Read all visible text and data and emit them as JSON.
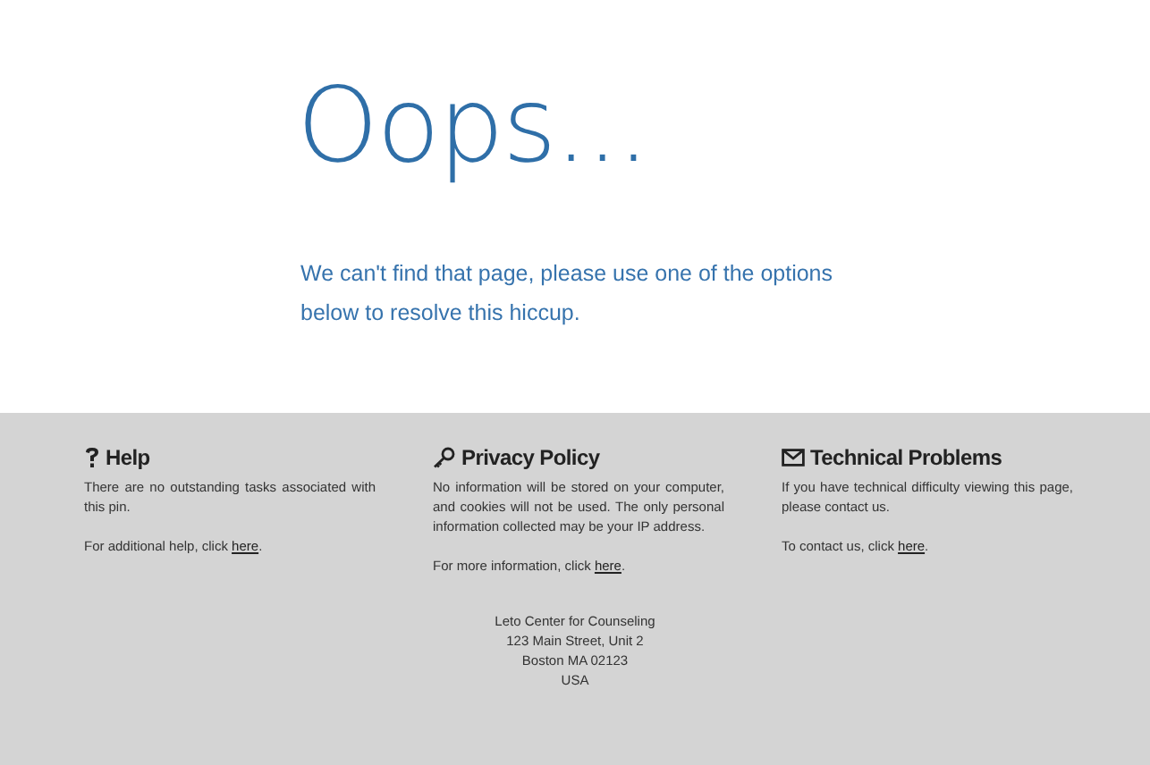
{
  "headline": "Oops...",
  "message": "We can't find that page, please use one of the options below to resolve this hiccup.",
  "footer": {
    "columns": [
      {
        "kind": "help",
        "title": "Help",
        "text": "There are no outstanding tasks associated with this pin.",
        "more": "For additional help, click ",
        "link": "here",
        "end": "."
      },
      {
        "kind": "privacy",
        "title": "Privacy Policy",
        "text": "No information will be stored on your computer, and cookies will not be used. The only personal information collected may be your IP address.",
        "more": "For more information, click ",
        "link": "here",
        "end": "."
      },
      {
        "kind": "contact",
        "title": "Technical Problems",
        "text": "If you have technical difficulty viewing this page, please contact us.",
        "more": "To contact us, click ",
        "link": "here",
        "end": "."
      }
    ],
    "address": [
      "Leto Center for Counseling",
      "123 Main Street, Unit 2",
      "Boston MA 02123",
      "USA"
    ]
  }
}
